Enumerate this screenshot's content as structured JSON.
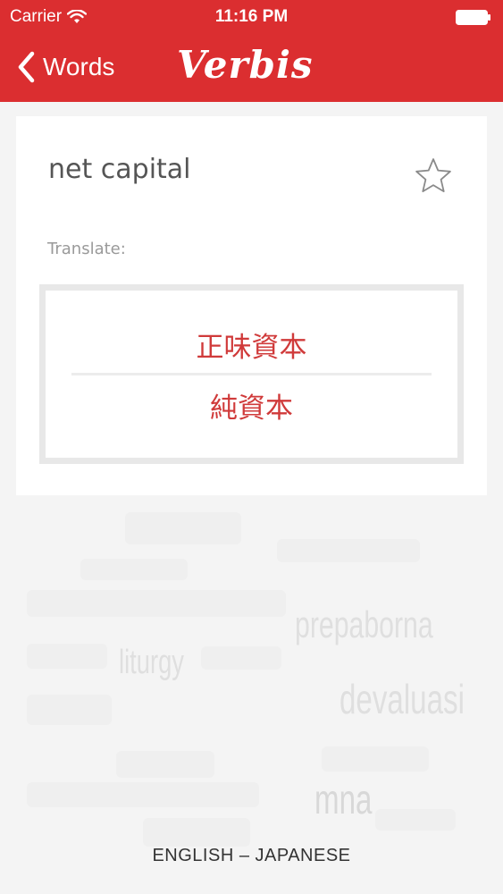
{
  "status_bar": {
    "carrier": "Carrier",
    "time": "11:16 PM"
  },
  "nav": {
    "back_label": "Words",
    "app_name": "Verbis"
  },
  "card": {
    "word": "net capital",
    "translate_label": "Translate:",
    "translations": [
      "正味資本",
      "純資本"
    ]
  },
  "background_words": [
    "liturgy",
    "prepaborna",
    "devaluasi",
    "mna"
  ],
  "footer": {
    "language_pair": "ENGLISH – JAPANESE"
  },
  "colors": {
    "brand": "#db2e30",
    "translation_text": "#d03a3a"
  }
}
